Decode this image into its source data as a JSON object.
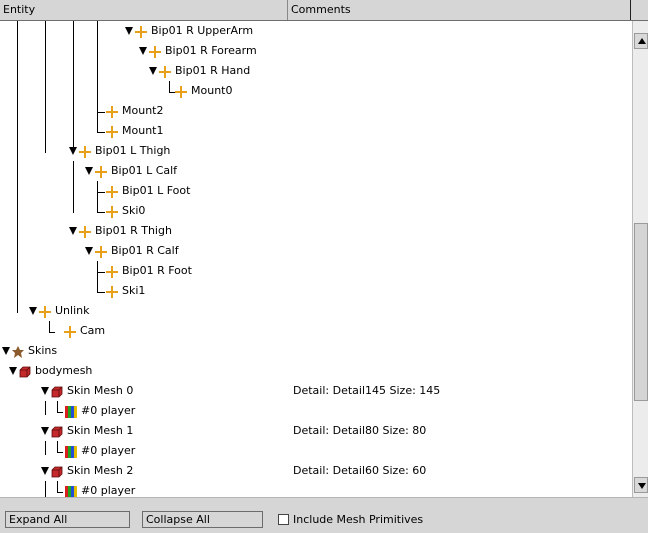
{
  "header": {
    "entity": "Entity",
    "comments": "Comments"
  },
  "tree": [
    {
      "label": "Bip01 R UpperArm",
      "icon": "bone-icon",
      "expanded": true,
      "comment": ""
    },
    {
      "label": "Bip01 R Forearm",
      "icon": "bone-icon",
      "expanded": true,
      "comment": ""
    },
    {
      "label": "Bip01 R Hand",
      "icon": "bone-icon",
      "expanded": true,
      "comment": ""
    },
    {
      "label": "Mount0",
      "icon": "bone-icon",
      "expanded": false,
      "comment": ""
    },
    {
      "label": "Mount2",
      "icon": "bone-icon",
      "expanded": false,
      "comment": ""
    },
    {
      "label": "Mount1",
      "icon": "bone-icon",
      "expanded": false,
      "comment": ""
    },
    {
      "label": "Bip01 L Thigh",
      "icon": "bone-icon",
      "expanded": true,
      "comment": ""
    },
    {
      "label": "Bip01 L Calf",
      "icon": "bone-icon",
      "expanded": true,
      "comment": ""
    },
    {
      "label": "Bip01 L Foot",
      "icon": "bone-icon",
      "expanded": false,
      "comment": ""
    },
    {
      "label": "Ski0",
      "icon": "bone-icon",
      "expanded": false,
      "comment": ""
    },
    {
      "label": "Bip01 R Thigh",
      "icon": "bone-icon",
      "expanded": true,
      "comment": ""
    },
    {
      "label": "Bip01 R Calf",
      "icon": "bone-icon",
      "expanded": true,
      "comment": ""
    },
    {
      "label": "Bip01 R Foot",
      "icon": "bone-icon",
      "expanded": false,
      "comment": ""
    },
    {
      "label": "Ski1",
      "icon": "bone-icon",
      "expanded": false,
      "comment": ""
    },
    {
      "label": "Unlink",
      "icon": "bone-icon",
      "expanded": true,
      "comment": ""
    },
    {
      "label": "Cam",
      "icon": "bone-icon",
      "expanded": false,
      "comment": ""
    },
    {
      "label": "Skins",
      "icon": "skins-icon",
      "expanded": true,
      "comment": ""
    },
    {
      "label": "bodymesh",
      "icon": "mesh-icon",
      "expanded": true,
      "comment": ""
    },
    {
      "label": "Skin Mesh 0",
      "icon": "mesh-icon",
      "expanded": true,
      "comment": "Detail: Detail145 Size: 145"
    },
    {
      "label": "#0 player",
      "icon": "material-icon",
      "expanded": false,
      "comment": ""
    },
    {
      "label": "Skin Mesh 1",
      "icon": "mesh-icon",
      "expanded": true,
      "comment": "Detail: Detail80 Size: 80"
    },
    {
      "label": "#0 player",
      "icon": "material-icon",
      "expanded": false,
      "comment": ""
    },
    {
      "label": "Skin Mesh 2",
      "icon": "mesh-icon",
      "expanded": true,
      "comment": "Detail: Detail60 Size: 60"
    },
    {
      "label": "#0 player",
      "icon": "material-icon",
      "expanded": false,
      "comment": ""
    }
  ],
  "footer": {
    "expand_all": "Expand All",
    "collapse_all": "Collapse All",
    "include_mesh_primitives": "Include Mesh Primitives",
    "include_mesh_primitives_checked": false
  },
  "colors": {
    "bone": "#e8a01a",
    "mesh": "#c42a2a",
    "skins": "#8a5a2a"
  }
}
